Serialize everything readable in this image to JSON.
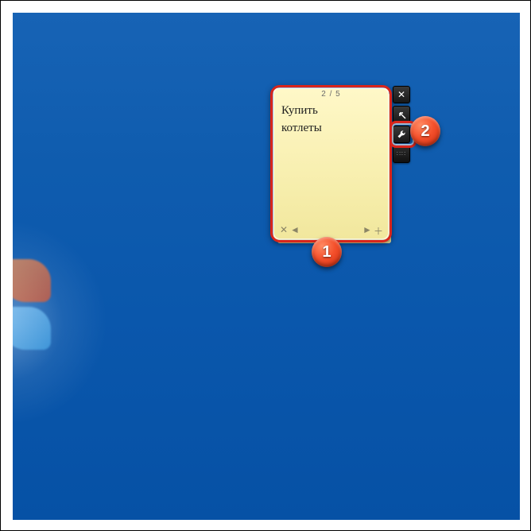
{
  "note": {
    "page_indicator": "2 / 5",
    "text_line1": "Купить",
    "text_line2": "котлеты",
    "nav": {
      "delete": "✕",
      "prev": "◄",
      "next": "►",
      "add": "＋"
    }
  },
  "controls": {
    "close": "✕",
    "enlarge": "↗",
    "settings": "wrench",
    "drag": ":::"
  },
  "callouts": {
    "one": "1",
    "two": "2"
  }
}
